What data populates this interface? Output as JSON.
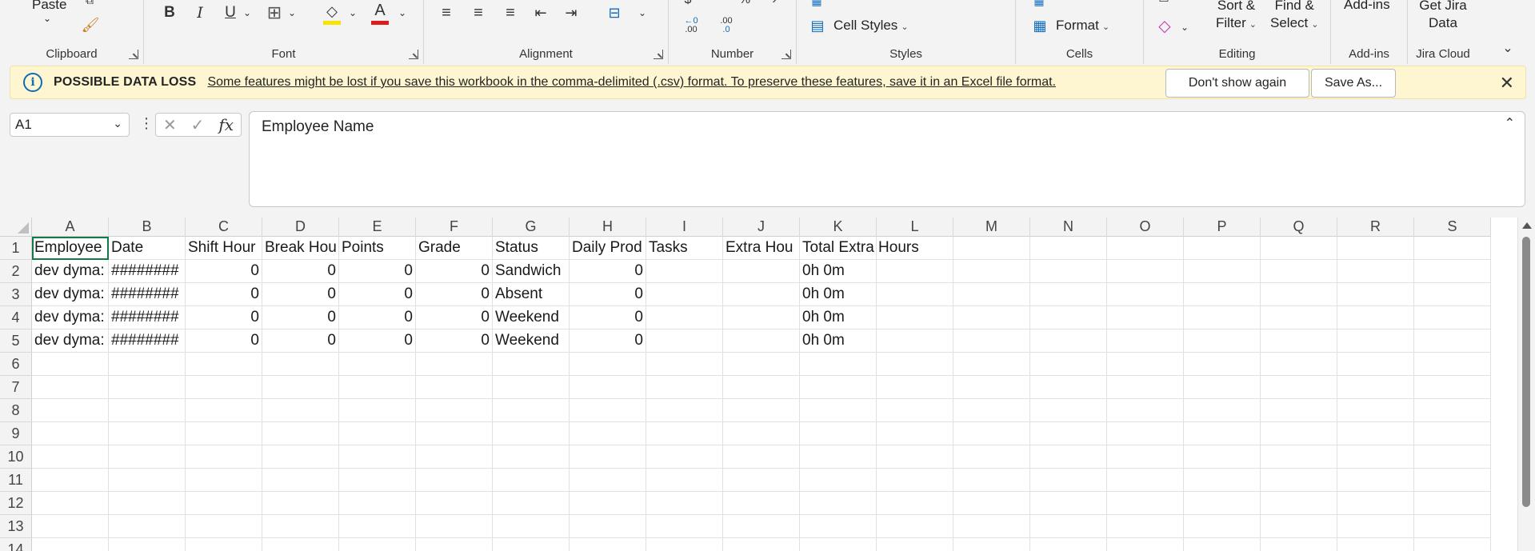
{
  "ribbon": {
    "clipboard": {
      "label": "Clipboard",
      "paste": "Paste"
    },
    "font": {
      "label": "Font",
      "bold": "B",
      "italic": "I",
      "underline": "U",
      "font_color_glyph": "A",
      "font_color": "#e01b1b",
      "highlight_color": "#f5e400"
    },
    "alignment": {
      "label": "Alignment"
    },
    "number": {
      "label": "Number",
      "inc_decimal": ".00",
      "dec_decimal": ".0"
    },
    "styles": {
      "label": "Styles",
      "cell_styles": "Cell Styles"
    },
    "cells": {
      "label": "Cells",
      "format": "Format"
    },
    "editing": {
      "label": "Editing",
      "sort_filter_1": "Sort &",
      "sort_filter_2": "Filter",
      "find_select_1": "Find &",
      "find_select_2": "Select"
    },
    "addins": {
      "label": "Add-ins",
      "button": "Add-ins"
    },
    "jira": {
      "label": "Jira Cloud",
      "button_1": "Get Jira",
      "button_2": "Data"
    }
  },
  "message_bar": {
    "title": "POSSIBLE DATA LOSS",
    "text": "Some features might be lost if you save this workbook in the comma-delimited (.csv) format. To preserve these features, save it in an Excel file format.",
    "dont_show": "Don't show again",
    "save_as": "Save As..."
  },
  "formula_bar": {
    "name_box": "A1",
    "fx": "fx",
    "content": "Employee Name"
  },
  "sheet": {
    "columns": [
      "A",
      "B",
      "C",
      "D",
      "E",
      "F",
      "G",
      "H",
      "I",
      "J",
      "K",
      "L",
      "M",
      "N",
      "O",
      "P",
      "Q",
      "R",
      "S"
    ],
    "row_numbers": [
      "1",
      "2",
      "3",
      "4",
      "5",
      "6",
      "7",
      "8",
      "9",
      "10",
      "11",
      "12",
      "13",
      "14"
    ],
    "rows": [
      [
        "Employee",
        "Date",
        "Shift Hour",
        "Break Hou",
        "Points",
        "Grade",
        "Status",
        "Daily Prod",
        "Tasks",
        "Extra Hou",
        "Total Extra Hours",
        "",
        "",
        "",
        "",
        "",
        "",
        "",
        ""
      ],
      [
        "dev dyma:",
        "########",
        "0",
        "0",
        "0",
        "0",
        "Sandwich",
        "0",
        "",
        "",
        "0h 0m",
        "",
        "",
        "",
        "",
        "",
        "",
        "",
        ""
      ],
      [
        "dev dyma:",
        "########",
        "0",
        "0",
        "0",
        "0",
        "Absent",
        "0",
        "",
        "",
        "0h 0m",
        "",
        "",
        "",
        "",
        "",
        "",
        "",
        ""
      ],
      [
        "dev dyma:",
        "########",
        "0",
        "0",
        "0",
        "0",
        "Weekend",
        "0",
        "",
        "",
        "0h 0m",
        "",
        "",
        "",
        "",
        "",
        "",
        "",
        ""
      ],
      [
        "dev dyma:",
        "########",
        "0",
        "0",
        "0",
        "0",
        "Weekend",
        "0",
        "",
        "",
        "0h 0m",
        "",
        "",
        "",
        "",
        "",
        "",
        "",
        ""
      ]
    ]
  }
}
